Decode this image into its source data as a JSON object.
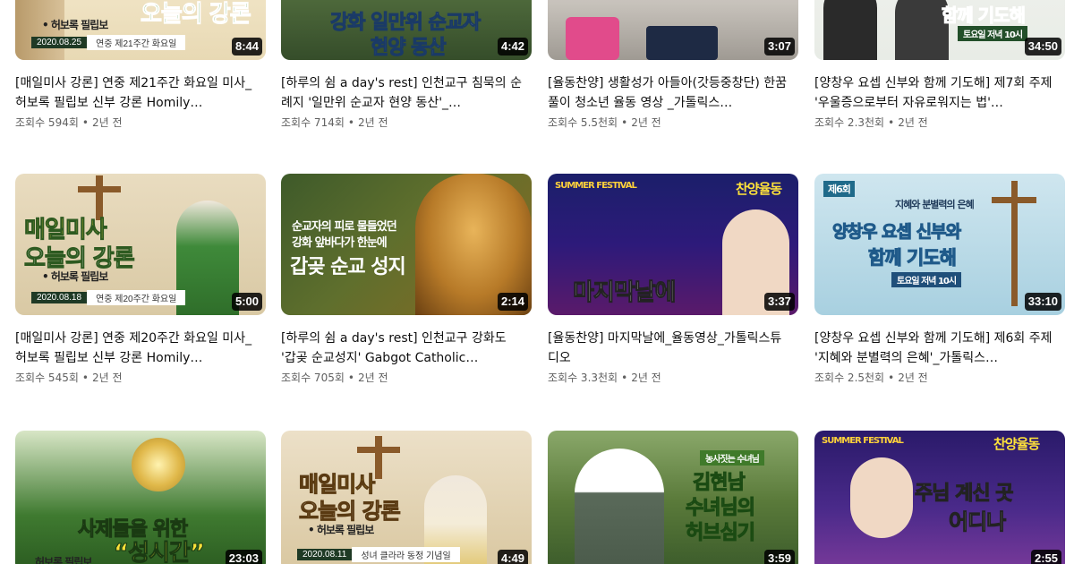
{
  "videos": [
    {
      "title": "[매일미사 강론] 연중 제21주간 화요일 미사_허보록 필립보 신부 강론 Homily…",
      "views": "조회수 594회",
      "age": "2년 전",
      "duration": "8:44",
      "thumb_text": "오늘의 강론",
      "thumb_sub": "• 허보록 필립보",
      "thumb_date": "2020.08.25",
      "thumb_date_sub": "연중 제21주간 화요일"
    },
    {
      "title": "[하루의 쉼 a day's rest] 인천교구 침묵의 순례지 '일만위 순교자 현양 동산'_…",
      "views": "조회수 714회",
      "age": "2년 전",
      "duration": "4:42",
      "thumb_text": "강화 일만위 순교자",
      "thumb_text2": "현양 동산"
    },
    {
      "title": "[율동찬양] 생활성가 아들아(갓등중창단) 한꿈풀이 청소년 율동 영상 _가톨릭스…",
      "views": "조회수 5.5천회",
      "age": "2년 전",
      "duration": "3:07"
    },
    {
      "title": "[양창우 요셉 신부와 함께 기도해] 제7회 주제 '우울증으로부터 자유로워지는 법'…",
      "views": "조회수 2.3천회",
      "age": "2년 전",
      "duration": "34:50",
      "thumb_text": "함께 기도해",
      "thumb_sub": "토요일 저녁 10시"
    },
    {
      "title": "[매일미사 강론] 연중 제20주간 화요일 미사_허보록 필립보 신부 강론 Homily…",
      "views": "조회수 545회",
      "age": "2년 전",
      "duration": "5:00",
      "thumb_text": "매일미사",
      "thumb_text2": "오늘의 강론",
      "thumb_sub": "• 허보록 필립보",
      "thumb_date": "2020.08.18",
      "thumb_date_sub": "연중 제20주간 화요일"
    },
    {
      "title": "[하루의 쉼 a day's rest] 인천교구 강화도 '갑곶 순교성지' Gabgot Catholic…",
      "views": "조회수 705회",
      "age": "2년 전",
      "duration": "2:14",
      "thumb_text": "순교자의 피로 물들었던",
      "thumb_text2": "강화 앞바다가 한눈에",
      "thumb_text3": "갑곶 순교 성지"
    },
    {
      "title": "[율동찬양] 마지막날에_율동영상_가톨릭스튜디오",
      "views": "조회수 3.3천회",
      "age": "2년 전",
      "duration": "3:37",
      "thumb_text": "마지막날에",
      "thumb_badge": "찬양율동",
      "thumb_festival": "SUMMER FESTIVAL"
    },
    {
      "title": "[양창우 요셉 신부와 함께 기도해] 제6회 주제 '지혜와 분별력의 은혜'_가톨릭스…",
      "views": "조회수 2.5천회",
      "age": "2년 전",
      "duration": "33:10",
      "thumb_text": "양창우 요셉 신부와",
      "thumb_text2": "함께 기도해",
      "thumb_sub": "토요일 저녁 10시",
      "thumb_top": "지혜와 분별력의 은혜",
      "thumb_ep": "제6회"
    },
    {
      "title": "",
      "views": "",
      "age": "",
      "duration": "23:03",
      "thumb_text": "사제들을 위한",
      "thumb_text2": "“성시간”",
      "thumb_sub": "허보록 필립보"
    },
    {
      "title": "",
      "views": "",
      "age": "",
      "duration": "4:49",
      "thumb_text": "매일미사",
      "thumb_text2": "오늘의 강론",
      "thumb_sub": "• 허보록 필립보",
      "thumb_date": "2020.08.11",
      "thumb_date_sub": "성녀 클라라 동정 기념일"
    },
    {
      "title": "",
      "views": "",
      "age": "",
      "duration": "3:59",
      "thumb_text": "김현남",
      "thumb_text2": "수녀님의",
      "thumb_text3": "허브심기",
      "thumb_badge": "농사짓는 수녀님"
    },
    {
      "title": "",
      "views": "",
      "age": "",
      "duration": "2:55",
      "thumb_text": "주님 계신 곳",
      "thumb_text2": "어디나",
      "thumb_badge": "찬양율동",
      "thumb_festival": "SUMMER FESTIVAL"
    }
  ],
  "colors": {
    "accent_green": "#2f7a2a",
    "meta_gray": "#606060"
  }
}
